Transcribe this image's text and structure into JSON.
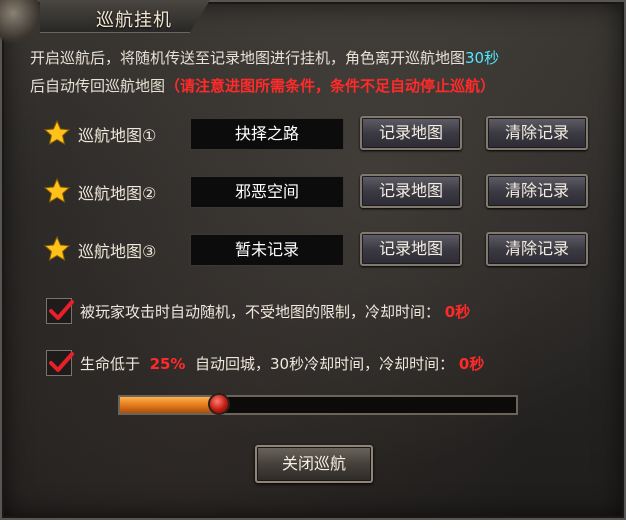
{
  "window": {
    "title": "巡航挂机",
    "close_icon": "close-x-icon"
  },
  "description": {
    "line1": "开启巡航后，将随机传送至记录地图进行挂机，角色离开巡航地图",
    "line1_time": "30秒",
    "line2": "后自动传回巡航地图",
    "warning": "（请注意进图所需条件，条件不足自动停止巡航）"
  },
  "maps": [
    {
      "label": "巡航地图①",
      "name": "抉择之路",
      "record_label": "记录地图",
      "clear_label": "清除记录",
      "icon": "star-icon"
    },
    {
      "label": "巡航地图②",
      "name": "邪恶空间",
      "record_label": "记录地图",
      "clear_label": "清除记录",
      "icon": "star-icon"
    },
    {
      "label": "巡航地图③",
      "name": "暂未记录",
      "record_label": "记录地图",
      "clear_label": "清除记录",
      "icon": "star-icon"
    }
  ],
  "options": {
    "attacked": {
      "checked": true,
      "text": "被玩家攻击时自动随机，不受地图的限制，冷却时间：",
      "cooldown": "0秒"
    },
    "low_hp": {
      "checked": true,
      "prefix": "生命低于",
      "percent": "25%",
      "text": "自动回城，30秒冷却时间，冷却时间：",
      "cooldown": "0秒"
    }
  },
  "slider": {
    "value_percent": 25
  },
  "close_button": {
    "label": "关闭巡航"
  },
  "colors": {
    "accent_cyan": "#4fe8ff",
    "warning_red": "#ff2a2a",
    "slider_orange": "#e0761a"
  }
}
